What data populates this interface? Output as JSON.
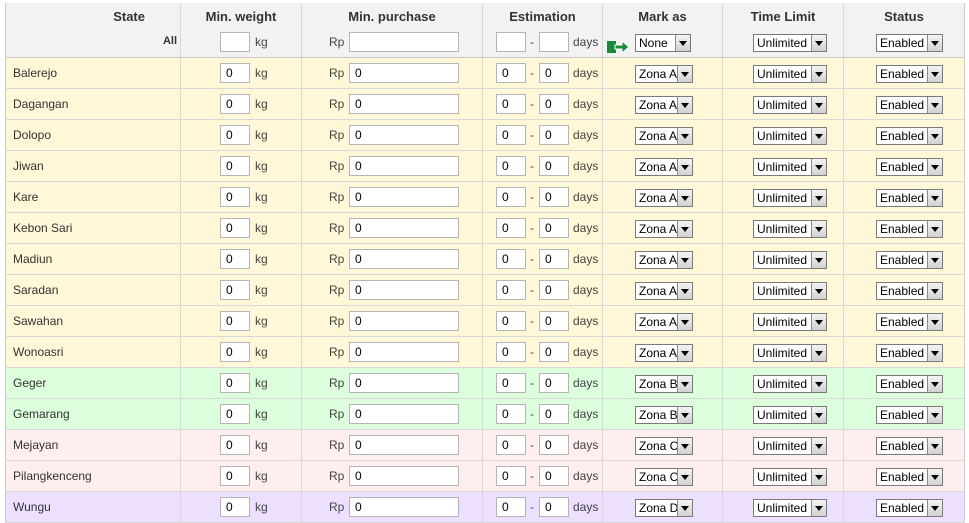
{
  "columns": {
    "state": "State",
    "min_weight": "Min. weight",
    "min_purchase": "Min. purchase",
    "estimation": "Estimation",
    "mark_as": "Mark as",
    "time_limit": "Time Limit",
    "status": "Status"
  },
  "units": {
    "kg": "kg",
    "currency": "Rp",
    "days": "days",
    "range_sep": "-"
  },
  "all_row": {
    "label": "All",
    "weight": "",
    "purchase": "",
    "est_min": "",
    "est_max": "",
    "mark": "None",
    "time_limit": "Unlimited",
    "status": "Enabled",
    "apply_icon": "apply-to-all-arrow-icon"
  },
  "colors": {
    "zona_a": "#fef8d8",
    "zona_b": "#ddfedd",
    "zona_c": "#feeeee",
    "zona_d": "#ece0fe",
    "apply_icon": "#1a8a3a"
  },
  "rows": [
    {
      "name": "Balerejo",
      "weight": "0",
      "purchase": "0",
      "est_min": "0",
      "est_max": "0",
      "mark": "Zona A",
      "zone": "a",
      "time_limit": "Unlimited",
      "status": "Enabled"
    },
    {
      "name": "Dagangan",
      "weight": "0",
      "purchase": "0",
      "est_min": "0",
      "est_max": "0",
      "mark": "Zona A",
      "zone": "a",
      "time_limit": "Unlimited",
      "status": "Enabled"
    },
    {
      "name": "Dolopo",
      "weight": "0",
      "purchase": "0",
      "est_min": "0",
      "est_max": "0",
      "mark": "Zona A",
      "zone": "a",
      "time_limit": "Unlimited",
      "status": "Enabled"
    },
    {
      "name": "Jiwan",
      "weight": "0",
      "purchase": "0",
      "est_min": "0",
      "est_max": "0",
      "mark": "Zona A",
      "zone": "a",
      "time_limit": "Unlimited",
      "status": "Enabled"
    },
    {
      "name": "Kare",
      "weight": "0",
      "purchase": "0",
      "est_min": "0",
      "est_max": "0",
      "mark": "Zona A",
      "zone": "a",
      "time_limit": "Unlimited",
      "status": "Enabled"
    },
    {
      "name": "Kebon Sari",
      "weight": "0",
      "purchase": "0",
      "est_min": "0",
      "est_max": "0",
      "mark": "Zona A",
      "zone": "a",
      "time_limit": "Unlimited",
      "status": "Enabled"
    },
    {
      "name": "Madiun",
      "weight": "0",
      "purchase": "0",
      "est_min": "0",
      "est_max": "0",
      "mark": "Zona A",
      "zone": "a",
      "time_limit": "Unlimited",
      "status": "Enabled"
    },
    {
      "name": "Saradan",
      "weight": "0",
      "purchase": "0",
      "est_min": "0",
      "est_max": "0",
      "mark": "Zona A",
      "zone": "a",
      "time_limit": "Unlimited",
      "status": "Enabled"
    },
    {
      "name": "Sawahan",
      "weight": "0",
      "purchase": "0",
      "est_min": "0",
      "est_max": "0",
      "mark": "Zona A",
      "zone": "a",
      "time_limit": "Unlimited",
      "status": "Enabled"
    },
    {
      "name": "Wonoasri",
      "weight": "0",
      "purchase": "0",
      "est_min": "0",
      "est_max": "0",
      "mark": "Zona A",
      "zone": "a",
      "time_limit": "Unlimited",
      "status": "Enabled"
    },
    {
      "name": "Geger",
      "weight": "0",
      "purchase": "0",
      "est_min": "0",
      "est_max": "0",
      "mark": "Zona B",
      "zone": "b",
      "time_limit": "Unlimited",
      "status": "Enabled"
    },
    {
      "name": "Gemarang",
      "weight": "0",
      "purchase": "0",
      "est_min": "0",
      "est_max": "0",
      "mark": "Zona B",
      "zone": "b",
      "time_limit": "Unlimited",
      "status": "Enabled"
    },
    {
      "name": "Mejayan",
      "weight": "0",
      "purchase": "0",
      "est_min": "0",
      "est_max": "0",
      "mark": "Zona C",
      "zone": "c",
      "time_limit": "Unlimited",
      "status": "Enabled"
    },
    {
      "name": "Pilangkenceng",
      "weight": "0",
      "purchase": "0",
      "est_min": "0",
      "est_max": "0",
      "mark": "Zona C",
      "zone": "c",
      "time_limit": "Unlimited",
      "status": "Enabled"
    },
    {
      "name": "Wungu",
      "weight": "0",
      "purchase": "0",
      "est_min": "0",
      "est_max": "0",
      "mark": "Zona D",
      "zone": "d",
      "time_limit": "Unlimited",
      "status": "Enabled"
    }
  ]
}
